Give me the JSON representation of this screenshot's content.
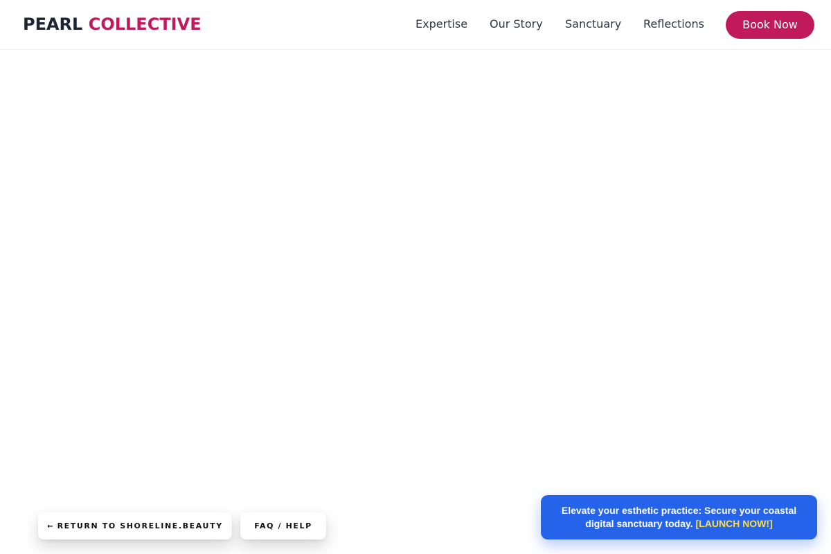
{
  "header": {
    "logo_part1": "PEARL",
    "logo_part2": "COLLECTIVE",
    "nav": {
      "expertise": "Expertise",
      "our_story": "Our Story",
      "sanctuary": "Sanctuary",
      "reflections": "Reflections"
    },
    "book_label": "Book Now"
  },
  "footer_pills": {
    "return_arrow": "←",
    "return_label": "RETURN TO SHORELINE.BEAUTY",
    "faq_label": "FAQ / HELP"
  },
  "promo": {
    "text": "Elevate your esthetic practice: Secure your coastal digital sanctuary today.",
    "cta": "[LAUNCH NOW!]"
  },
  "colors": {
    "brand_dark": "#1c2434",
    "brand_accent": "#c01a5d",
    "promo_blue": "#2563eb",
    "promo_cta": "#fde047"
  }
}
